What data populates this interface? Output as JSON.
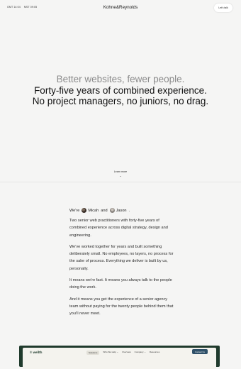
{
  "header": {
    "clock_1": "GMT 14:04",
    "clock_2": "MST 09:05",
    "brand": "Kohne&Reynolds",
    "cta_label": "Let's talk"
  },
  "hero": {
    "lead": "Better websites, fewer people.",
    "line_1": "Forty-five years of combined experience.",
    "line_2": "No project managers, no juniors, no drag."
  },
  "learn_more": {
    "label": "Learn more",
    "arrow": "⌄"
  },
  "about": {
    "were_prefix": "We're",
    "person_1": "Micah",
    "and_word": "and",
    "person_2": "Jason",
    "period": ".",
    "paragraphs": [
      "Two senior web practitioners with forty-five years of combined experience across digital strategy, design and engineering.",
      "We've worked together for years and built something deliberately small. No employees, no layers, no process for the sake of process. Everything we deliver is built by us, personally.",
      "It means we're fast. It means you always talk to the people doing the work.",
      "And it means you get the experience of a senior agency team without paying for the twenty people behind them that you'll never meet."
    ]
  },
  "preview": {
    "logo": "wellth",
    "nav": [
      "Solutions",
      "Who We Help ⌄",
      "Overview",
      "Company ⌄",
      "Resources"
    ],
    "contact": "Contact Us"
  },
  "colors": {
    "background": "#f5f5f4",
    "hero_muted": "#8c8c8c",
    "preview_dark_green": "#1f3a2c",
    "preview_button": "#2f5068"
  }
}
